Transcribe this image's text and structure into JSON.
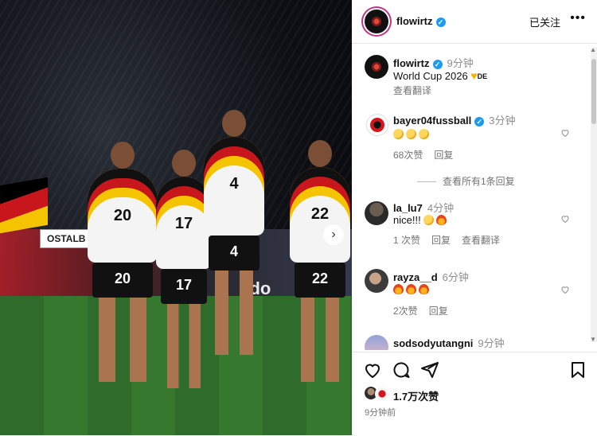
{
  "header": {
    "username": "flowirtz",
    "follow_label": "已关注",
    "more_label": "•••"
  },
  "caption": {
    "username": "flowirtz",
    "time": "9分钟",
    "text": "World Cup 2026",
    "emoji_suffix": "DE",
    "translate": "查看翻译"
  },
  "comments": [
    {
      "username": "bayer04fussball",
      "time": "3分钟",
      "text": "",
      "likes": "68次赞",
      "reply": "回复",
      "view_replies": "查看所有1条回复"
    },
    {
      "username": "la_lu7",
      "time": "4分钟",
      "text": "nice!!!",
      "likes": "1 次赞",
      "reply": "回复",
      "translate": "查看翻译"
    },
    {
      "username": "rayza__d",
      "time": "6分钟",
      "text": "",
      "likes": "2次赞",
      "reply": "回复"
    },
    {
      "username": "sodsodyutangni",
      "time": "9分钟"
    }
  ],
  "photo": {
    "board_logo": "OSTALB",
    "board_text": "ndo",
    "jersey_numbers": [
      "20",
      "17",
      "4",
      "22"
    ],
    "shorts_numbers": [
      "20",
      "17",
      "4",
      "22"
    ]
  },
  "footer": {
    "likes": "1.7万次赞",
    "posted": "9分钟前"
  },
  "colors": {
    "verified": "#1d9bf0",
    "muted": "#737373",
    "accent_ring": "#c13584"
  }
}
